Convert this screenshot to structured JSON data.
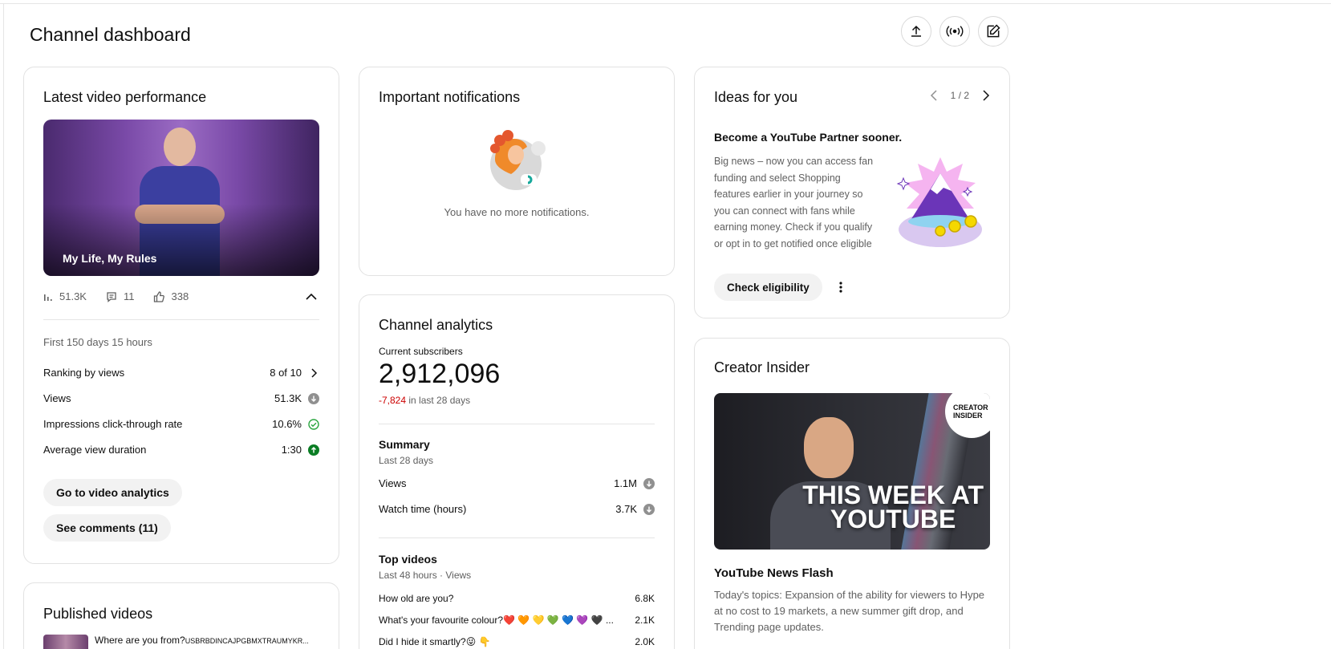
{
  "page_title": "Channel dashboard",
  "header_actions": [
    {
      "icon": "upload-icon"
    },
    {
      "icon": "live-icon"
    },
    {
      "icon": "create-post-icon"
    }
  ],
  "latest_video": {
    "title": "Latest video performance",
    "video_title": "My Life, My Rules",
    "views": "51.3K",
    "comments": "11",
    "likes": "338",
    "period": "First 150 days 15 hours",
    "metrics": [
      {
        "label": "Ranking by views",
        "value": "8 of 10",
        "indicator": "chevron"
      },
      {
        "label": "Views",
        "value": "51.3K",
        "indicator": "down"
      },
      {
        "label": "Impressions click-through rate",
        "value": "10.6%",
        "indicator": "check"
      },
      {
        "label": "Average view duration",
        "value": "1:30",
        "indicator": "up"
      }
    ],
    "analytics_button": "Go to video analytics",
    "comments_button": "See comments (11)"
  },
  "published_videos": {
    "title": "Published videos",
    "first_video": "Where are you from?",
    "first_video_tag": "USBRBDINCAJPGBMXTRAUMYKR..."
  },
  "notifications": {
    "title": "Important notifications",
    "empty_text": "You have no more notifications."
  },
  "analytics": {
    "title": "Channel analytics",
    "subscribers_label": "Current subscribers",
    "subscribers": "2,912,096",
    "change": "-7,824",
    "change_period": "in last 28 days",
    "summary_title": "Summary",
    "summary_period": "Last 28 days",
    "summary_rows": [
      {
        "label": "Views",
        "value": "1.1M"
      },
      {
        "label": "Watch time (hours)",
        "value": "3.7K"
      }
    ],
    "top_title": "Top videos",
    "top_period": "Last 48 hours · Views",
    "top_videos": [
      {
        "title": "How old are you?",
        "value": "6.8K"
      },
      {
        "title": "What's your favourite colour?❤️ 🧡 💛 💚 💙 💜 🖤 ...",
        "value": "2.1K"
      },
      {
        "title": "Did I hide it smartly?😜 👇",
        "value": "2.0K"
      }
    ]
  },
  "ideas": {
    "title": "Ideas for you",
    "pager": "1 / 2",
    "headline": "Become a YouTube Partner sooner.",
    "body": "Big news – now you can access fan funding and select Shopping features earlier in your journey so you can connect with fans while earning money. Check if you qualify or opt in to get notified once eligible",
    "button": "Check eligibility"
  },
  "creator_insider": {
    "title": "Creator Insider",
    "badge_line1": "CREATOR",
    "badge_line2": "INSIDER",
    "thumb_line1": "THIS WEEK AT",
    "thumb_line2": "YOUTUBE",
    "video_title": "YouTube News Flash",
    "description": "Today's topics: Expansion of the ability for viewers to Hype at no cost to 19 markets, a new summer gift drop, and Trending page updates."
  },
  "colors": {
    "negative": "#cc0000",
    "positive": "#0a7d24",
    "check": "#2ba640"
  }
}
